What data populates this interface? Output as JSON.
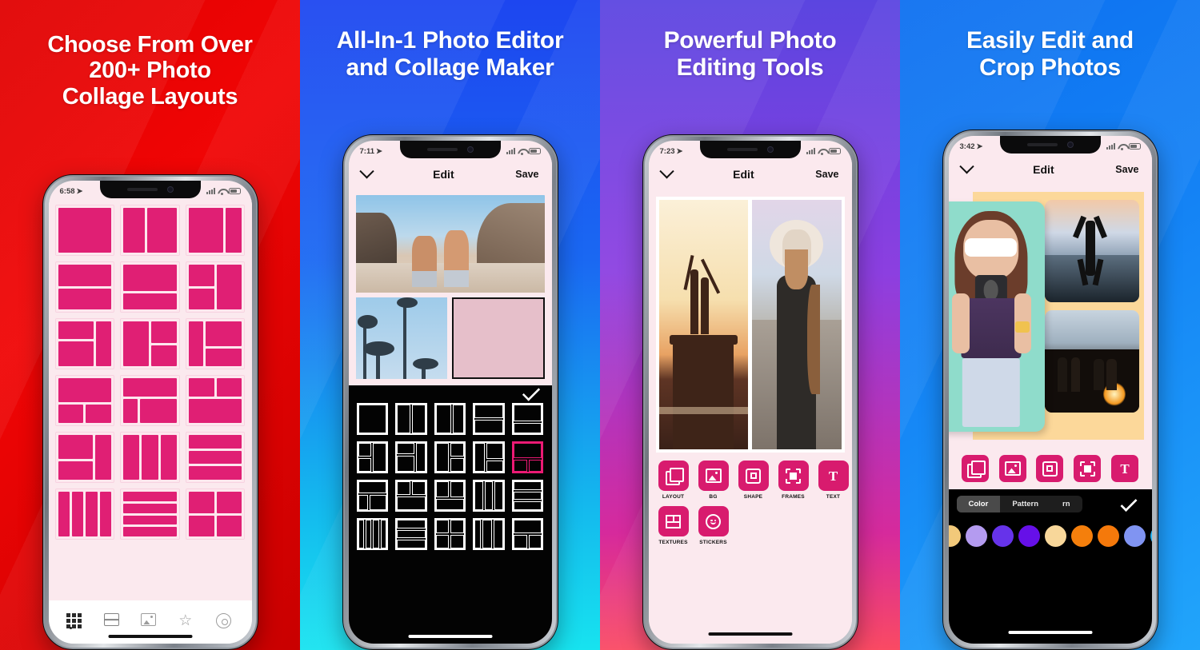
{
  "panels": [
    {
      "headline": "Choose From Over\n200+ Photo\nCollage Layouts",
      "bg": "#ef0000",
      "phone": {
        "status": {
          "time": "6:58"
        },
        "tabbar": [
          "grid-icon",
          "split-icon",
          "image-icon",
          "star-icon",
          "gear-icon"
        ]
      }
    },
    {
      "headline": "All-In-1 Photo Editor\nand Collage Maker",
      "bg": "#1a5af2",
      "phone": {
        "status": {
          "time": "7:11"
        },
        "nav": {
          "back": "chevron-down-icon",
          "title": "Edit",
          "save": "Save"
        },
        "picker": {
          "selected_index": 9,
          "confirm": "check-icon"
        }
      }
    },
    {
      "headline": "Powerful Photo\nEditing Tools",
      "bg": "#8c3fe0",
      "phone": {
        "status": {
          "time": "7:23"
        },
        "nav": {
          "back": "chevron-down-icon",
          "title": "Edit",
          "save": "Save"
        },
        "tools_row1": [
          {
            "label": "LAYOUT",
            "icon": "layers-icon"
          },
          {
            "label": "BG",
            "icon": "background-image-icon"
          },
          {
            "label": "SHAPE",
            "icon": "shape-icon"
          },
          {
            "label": "FRAMES",
            "icon": "frame-icon"
          },
          {
            "label": "TEXT",
            "icon": "text-icon"
          }
        ],
        "tools_row2": [
          {
            "label": "TEXTURES",
            "icon": "texture-icon"
          },
          {
            "label": "STICKERS",
            "icon": "sticker-smiley-icon"
          }
        ]
      }
    },
    {
      "headline": "Easily Edit and\nCrop Photos",
      "bg": "#1483f5",
      "phone": {
        "status": {
          "time": "3:42"
        },
        "nav": {
          "back": "chevron-down-icon",
          "title": "Edit",
          "save": "Save"
        },
        "toolbar": [
          "layers-icon",
          "background-image-icon",
          "shape-icon",
          "frame-icon",
          "text-icon"
        ],
        "segmented": {
          "options": [
            "Color",
            "Pattern",
            "rn"
          ],
          "selected": "Color"
        },
        "swatches": [
          "#b49bf0",
          "#6633ea",
          "#6610e8",
          "#f8d79a",
          "#f57f0c",
          "#f5790b",
          "#8094f2",
          "#24b6f5"
        ],
        "confirm": "check-icon"
      }
    }
  ],
  "layout_thumbs": [
    [
      [
        1,
        1,
        1,
        1
      ]
    ],
    [
      [
        1,
        1
      ],
      [
        1,
        1
      ]
    ],
    [
      [
        1,
        1
      ],
      [
        1,
        1
      ]
    ],
    [
      [
        1
      ],
      [
        1
      ]
    ],
    [
      [
        1
      ],
      [
        1
      ]
    ],
    [
      [
        1,
        1
      ],
      [
        1,
        1
      ]
    ],
    [
      [
        1,
        1
      ],
      [
        1,
        1
      ]
    ],
    [
      [
        1,
        1
      ],
      [
        1,
        1
      ]
    ],
    [
      [
        1,
        1
      ],
      [
        1,
        1
      ]
    ],
    [
      [
        1
      ],
      [
        1
      ],
      [
        1
      ]
    ],
    [
      [
        1,
        1
      ],
      [
        1,
        1
      ]
    ],
    [
      [
        1,
        1
      ],
      [
        1,
        1
      ]
    ],
    [
      [
        1,
        1,
        1,
        1
      ]
    ],
    [
      [
        1
      ],
      [
        1
      ],
      [
        1
      ]
    ],
    [
      [
        1,
        1
      ],
      [
        1,
        1
      ]
    ]
  ],
  "colors": {
    "accent_pink": "#e01f74",
    "tool_pink": "#d81b6e",
    "screen_bg": "#fbe9ee",
    "picker_bg": "#030303",
    "selected_layout": "#ec1a74"
  }
}
